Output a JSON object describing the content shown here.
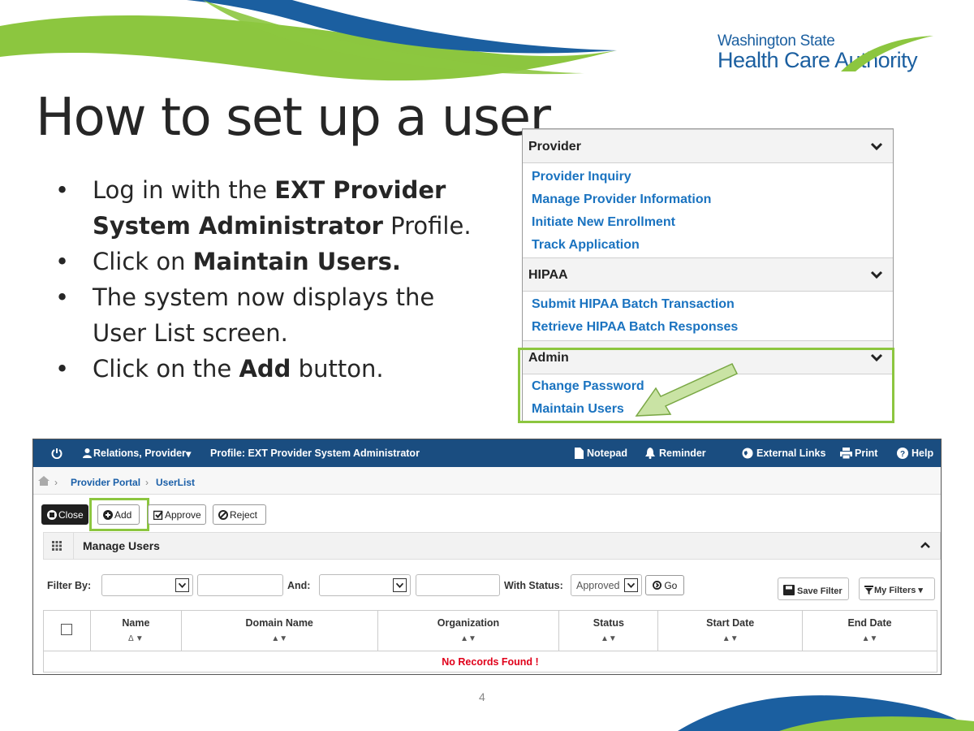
{
  "logo": {
    "line1": "Washington State",
    "line2_a": "Health Care ",
    "line2_b": "uthority"
  },
  "slide": {
    "title": "How to set up a user",
    "page_number": "4"
  },
  "bullets": [
    {
      "pre": "Log in with the ",
      "bold": "EXT Provider System Administrator",
      "post": " Profile."
    },
    {
      "pre": "Click on ",
      "bold": "Maintain Users.",
      "post": ""
    },
    {
      "pre": "The system now displays the User List screen.",
      "bold": "",
      "post": ""
    },
    {
      "pre": "Click on the ",
      "bold": "Add",
      "post": " button."
    }
  ],
  "menu": {
    "sections": [
      {
        "title": "Provider",
        "links": [
          "Provider Inquiry",
          "Manage Provider Information",
          "Initiate New Enrollment",
          "Track Application"
        ]
      },
      {
        "title": "HIPAA",
        "links": [
          "Submit HIPAA Batch Transaction",
          "Retrieve HIPAA Batch Responses"
        ]
      },
      {
        "title": "Admin",
        "links": [
          "Change Password",
          "Maintain Users"
        ]
      }
    ]
  },
  "portal": {
    "topbar": {
      "user": "Relations, Provider",
      "profile": "Profile: EXT Provider System Administrator",
      "notepad": "Notepad",
      "reminder": "Reminder",
      "external_links": "External Links",
      "print": "Print",
      "help": "Help"
    },
    "breadcrumb": {
      "portal": "Provider Portal",
      "page": "UserList"
    },
    "buttons": {
      "close": "Close",
      "add": "Add",
      "approve": "Approve",
      "reject": "Reject"
    },
    "panel_title": "Manage Users",
    "filter": {
      "filter_by_label": "Filter By:",
      "and_label": "And:",
      "with_status_label": "With Status:",
      "status_value": "Approved",
      "go": "Go",
      "save_filter": "Save Filter",
      "my_filters": "My Filters"
    },
    "table": {
      "columns": [
        "Name",
        "Domain Name",
        "Organization",
        "Status",
        "Start Date",
        "End Date"
      ],
      "name_sort": "Δ ▼",
      "sort": "▲▼",
      "empty_message": "No Records Found !"
    }
  },
  "colors": {
    "brand_blue": "#1b5fa0",
    "brand_green": "#8cc63f",
    "portal_bar": "#1a4d80",
    "link_blue": "#1a73c0",
    "error_red": "#e0001a"
  }
}
